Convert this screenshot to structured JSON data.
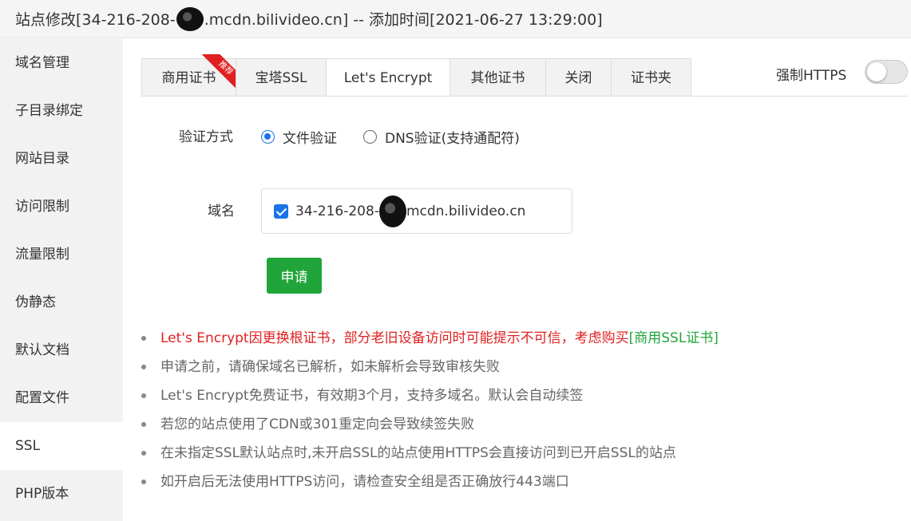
{
  "window": {
    "title_prefix": "站点修改[34-216-208-",
    "title_suffix": ".mcdn.bilivideo.cn] -- 添加时间[2021-06-27 13:29:00]"
  },
  "sidebar": {
    "items": [
      {
        "label": "域名管理"
      },
      {
        "label": "子目录绑定"
      },
      {
        "label": "网站目录"
      },
      {
        "label": "访问限制"
      },
      {
        "label": "流量限制"
      },
      {
        "label": "伪静态"
      },
      {
        "label": "默认文档"
      },
      {
        "label": "配置文件"
      },
      {
        "label": "SSL"
      },
      {
        "label": "PHP版本"
      }
    ],
    "active_index": 8
  },
  "tabs": {
    "items": [
      {
        "label": "商用证书",
        "badge": "推荐"
      },
      {
        "label": "宝塔SSL"
      },
      {
        "label": "Let's Encrypt"
      },
      {
        "label": "其他证书"
      },
      {
        "label": "关闭"
      },
      {
        "label": "证书夹"
      }
    ],
    "active_index": 2
  },
  "force_https": {
    "label": "强制HTTPS",
    "enabled": false
  },
  "form": {
    "verify_label": "验证方式",
    "verify_options": [
      {
        "label": "文件验证",
        "selected": true
      },
      {
        "label": "DNS验证(支持通配符)",
        "selected": false
      }
    ],
    "domain_label": "域名",
    "domain_prefix": "34-216-208-",
    "domain_suffix": "mcdn.bilivideo.cn",
    "domain_checked": true,
    "apply_label": "申请"
  },
  "tips": {
    "warn_text": "Let's Encrypt因更换根证书，部分老旧设备访问时可能提示不可信，考虑购买",
    "warn_link": "[商用SSL证书]",
    "items": [
      "申请之前，请确保域名已解析，如未解析会导致审核失败",
      "Let's Encrypt免费证书，有效期3个月，支持多域名。默认会自动续签",
      "若您的站点使用了CDN或301重定向会导致续签失败",
      "在未指定SSL默认站点时,未开启SSL的站点使用HTTPS会直接访问到已开启SSL的站点",
      "如开启后无法使用HTTPS访问，请检查安全组是否正确放行443端口"
    ]
  },
  "colors": {
    "accent_green": "#20a53a",
    "warn_red": "#e02020",
    "radio_blue": "#1a73e8"
  }
}
